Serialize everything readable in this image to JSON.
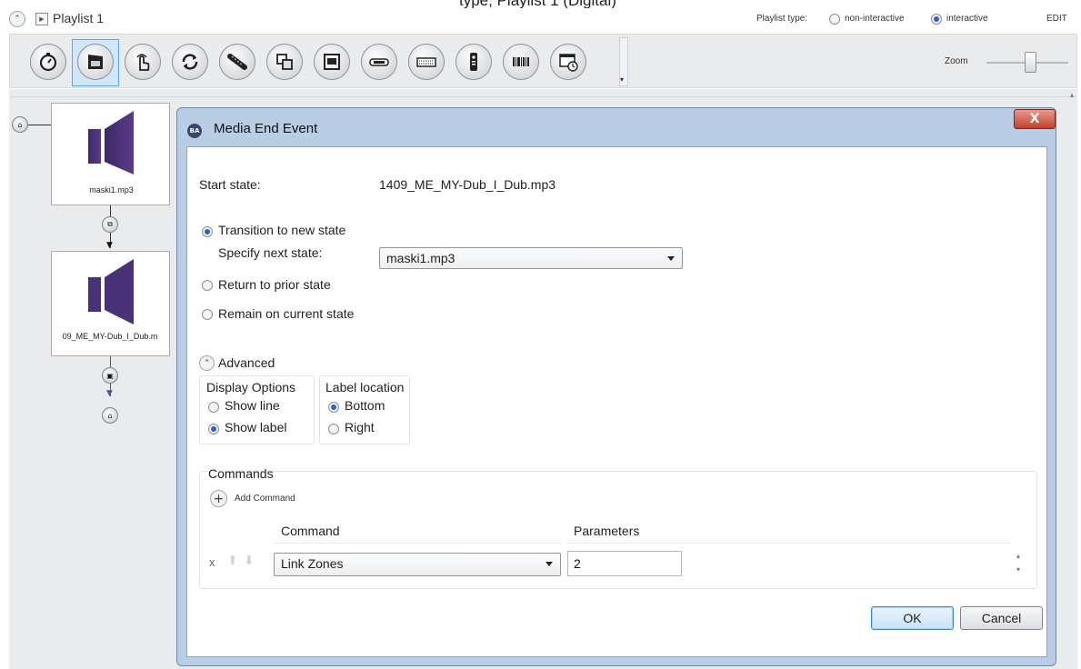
{
  "window_title_fragment": "type; Playlist 1 (Digital)",
  "topbar": {
    "playlist_label": "Playlist 1",
    "playlist_type_label": "Playlist type:",
    "non_interactive_label": "non-interactive",
    "interactive_label": "interactive",
    "playlist_type_selected": "interactive",
    "edit_label": "EDIT",
    "zoom_label": "Zoom"
  },
  "toolbar": {
    "tools": [
      "timer-icon",
      "video-clip-icon",
      "touch-icon",
      "refresh-icon",
      "serial-icon",
      "zone-icon",
      "rectangle-icon",
      "usb-icon",
      "keyboard-icon",
      "remote-icon",
      "barcode-icon",
      "calendar-clip-icon"
    ],
    "selected_tool": "video-clip-icon"
  },
  "canvas": {
    "states": [
      {
        "label": "maski1.mp3"
      },
      {
        "label": "09_ME_MY-Dub_I_Dub.m"
      }
    ]
  },
  "dialog": {
    "title": "Media End Event",
    "icon_text": "BA",
    "close_label": "X",
    "start_state_label": "Start state:",
    "start_state_value": "1409_ME_MY-Dub_I_Dub.mp3",
    "transition_label": "Transition to new state",
    "specify_next_label": "Specify next state:",
    "next_state_value": "maski1.mp3",
    "return_label": "Return to prior state",
    "remain_label": "Remain on current state",
    "selected_transition": "Transition to new state",
    "advanced_label": "Advanced",
    "display_options_label": "Display Options",
    "show_line_label": "Show line",
    "show_label_label": "Show label",
    "display_selected": "Show label",
    "label_location_label": "Label location",
    "bottom_label": "Bottom",
    "right_label": "Right",
    "location_selected": "Bottom",
    "commands_label": "Commands",
    "add_command_label": "Add Command",
    "command_col_header": "Command",
    "parameters_col_header": "Parameters",
    "remove_row_label": "x",
    "command_value": "Link Zones",
    "parameter_value": "2",
    "ok_label": "OK",
    "cancel_label": "Cancel"
  }
}
